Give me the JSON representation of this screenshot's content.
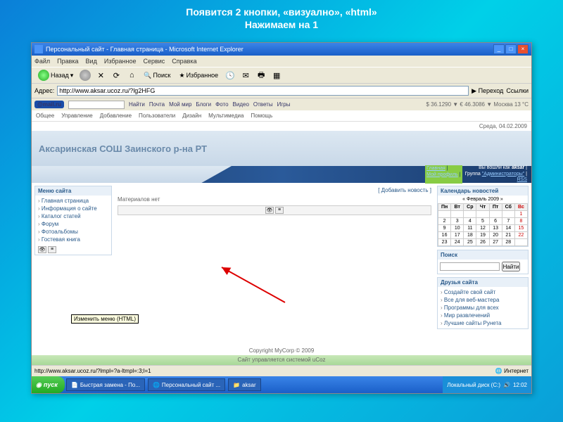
{
  "slide": {
    "title_line1": "Появится 2 кнопки, «визуално», «html»",
    "title_line2": "Нажимаем на 1"
  },
  "browser": {
    "title": "Персональный сайт - Главная страница - Microsoft Internet Explorer",
    "menu": [
      "Файл",
      "Правка",
      "Вид",
      "Избранное",
      "Сервис",
      "Справка"
    ],
    "back_label": "Назад",
    "search_label": "Поиск",
    "fav_label": "Избранное",
    "addr_label": "Адрес:",
    "url": "http://www.aksar.ucoz.ru/?lg2HFG",
    "go_label": "Переход",
    "links_label": "Ссылки"
  },
  "mailru": {
    "logo": "@mail.ru",
    "items": [
      "Найти",
      "Почта",
      "Мой мир",
      "Блоги",
      "Фото",
      "Видео",
      "Ответы",
      "Игры"
    ],
    "right": "$ 36.1290 ▼  € 46.3086 ▼   Москва 13 °C"
  },
  "ucoz": {
    "menu": [
      "Общее",
      "Управление",
      "Добавление",
      "Пользователи",
      "Дизайн",
      "Мультимедиа",
      "Помощь"
    ],
    "date": "Среда, 04.02.2009",
    "site_name": "Аксаринская СОШ Заинского р-на РТ",
    "login": {
      "main": "Главная",
      "profile": "Мой профиль",
      "logged_as": "Вы вошли как",
      "user": "aksar",
      "group_label": "Группа",
      "group": "\"Администраторы\"",
      "rss": "RSS"
    }
  },
  "menu_block": {
    "title": "Меню сайта",
    "items": [
      "Главная страница",
      "Информация о сайте",
      "Каталог статей",
      "Форум",
      "Фотоальбомы",
      "Гостевая книга"
    ]
  },
  "tooltip": "Изменить меню (HTML)",
  "mid": {
    "add_news": "[ Добавить новость ]",
    "no_materials": "Материалов нет"
  },
  "calendar": {
    "title": "Календарь новостей",
    "month": "« Февраль 2009 »",
    "days": [
      "Пн",
      "Вт",
      "Ср",
      "Чт",
      "Пт",
      "Сб",
      "Вс"
    ],
    "rows": [
      [
        "",
        "",
        "",
        "",
        "",
        "",
        "1"
      ],
      [
        "2",
        "3",
        "4",
        "5",
        "6",
        "7",
        "8"
      ],
      [
        "9",
        "10",
        "11",
        "12",
        "13",
        "14",
        "15"
      ],
      [
        "16",
        "17",
        "18",
        "19",
        "20",
        "21",
        "22"
      ],
      [
        "23",
        "24",
        "25",
        "26",
        "27",
        "28",
        ""
      ]
    ]
  },
  "search": {
    "title": "Поиск",
    "btn": "Найти"
  },
  "friends": {
    "title": "Друзья сайта",
    "items": [
      "Создайте свой сайт",
      "Все для веб-мастера",
      "Программы для всех",
      "Мир развлечений",
      "Лучшие сайты Рунета"
    ]
  },
  "footer": {
    "copy": "Copyright MyCorp © 2009",
    "sys": "Сайт управляется системой uCoz"
  },
  "status": {
    "url": "http://www.aksar.ucoz.ru/?lmpl=?a-ltmpl=:3;l=1",
    "zone": "Интернет"
  },
  "taskbar": {
    "start": "пуск",
    "items": [
      "Быстрая замена - По...",
      "Персональный сайт ...",
      "aksar"
    ],
    "disk": "Локальный диск (С:)",
    "time": "12:02"
  }
}
